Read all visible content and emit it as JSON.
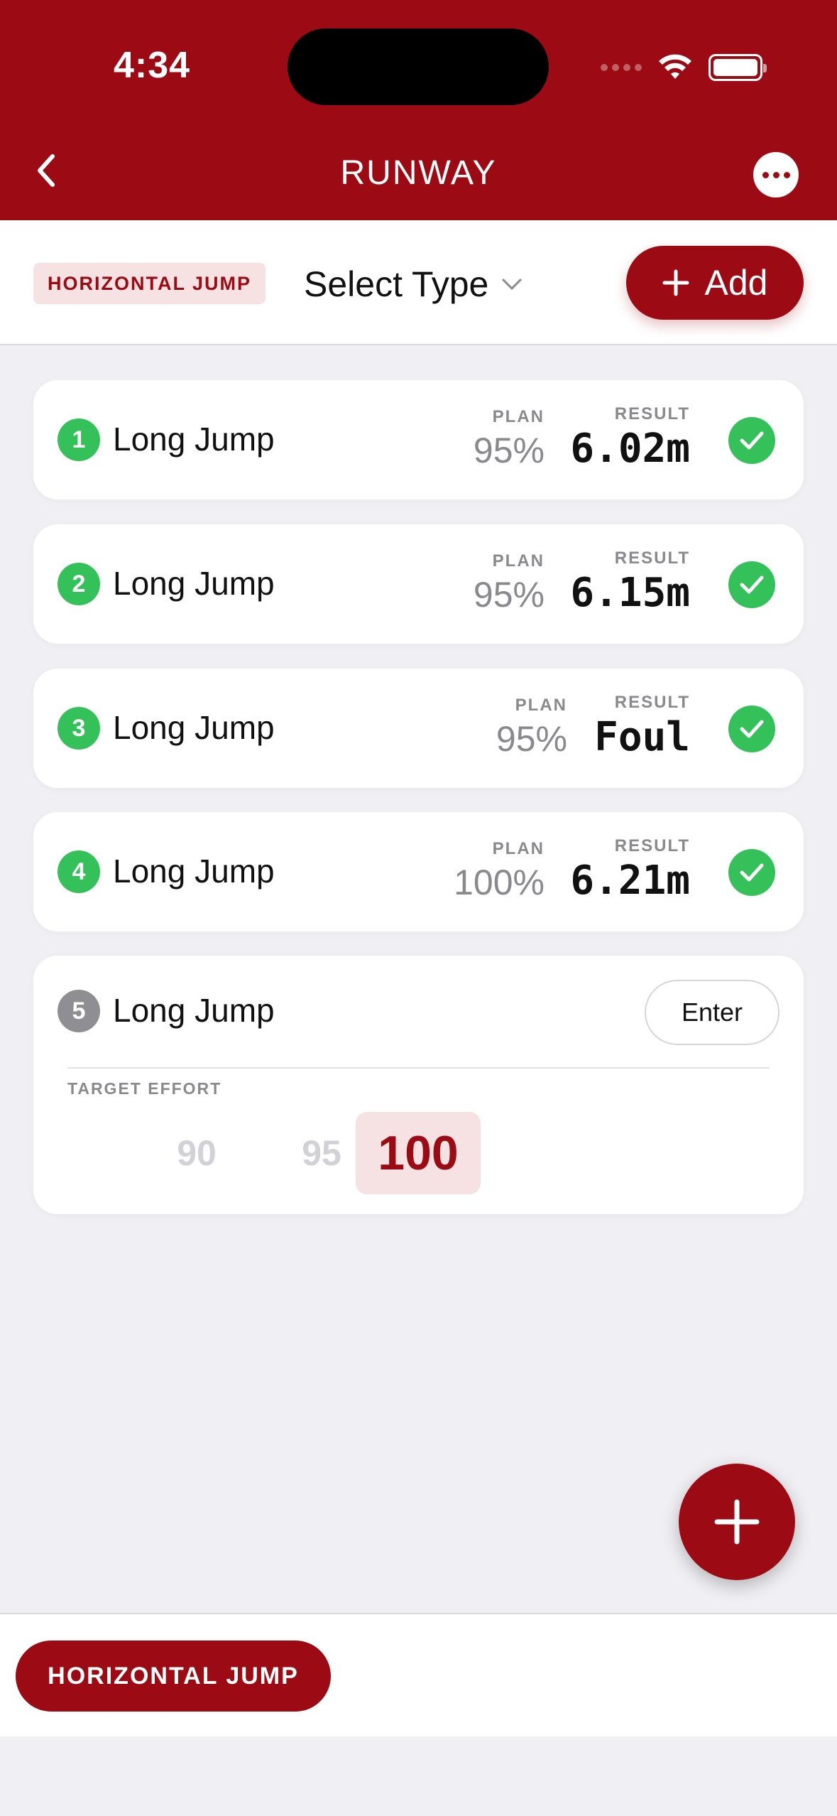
{
  "status_bar": {
    "time": "4:34"
  },
  "nav": {
    "title": "RUNWAY"
  },
  "toolbar": {
    "category_badge": "HORIZONTAL JUMP",
    "type_select": "Select Type",
    "add_label": "Add"
  },
  "labels": {
    "plan": "PLAN",
    "result": "RESULT"
  },
  "jumps": [
    {
      "number": "1",
      "name": "Long Jump",
      "plan": "95%",
      "result": "6.02m",
      "completed": true
    },
    {
      "number": "2",
      "name": "Long Jump",
      "plan": "95%",
      "result": "6.15m",
      "completed": true
    },
    {
      "number": "3",
      "name": "Long Jump",
      "plan": "95%",
      "result": "Foul",
      "completed": true
    },
    {
      "number": "4",
      "name": "Long Jump",
      "plan": "100%",
      "result": "6.21m",
      "completed": true
    }
  ],
  "current_jump": {
    "number": "5",
    "name": "Long Jump",
    "enter_label": "Enter",
    "effort_label": "TARGET EFFORT",
    "effort_options": [
      "90",
      "95",
      "100"
    ],
    "selected_effort": "100"
  },
  "bottom_bar": {
    "chip_label": "HORIZONTAL JUMP"
  },
  "colors": {
    "brand": "#9c0b13",
    "success": "#34c15a",
    "muted": "#8a8a8e"
  }
}
